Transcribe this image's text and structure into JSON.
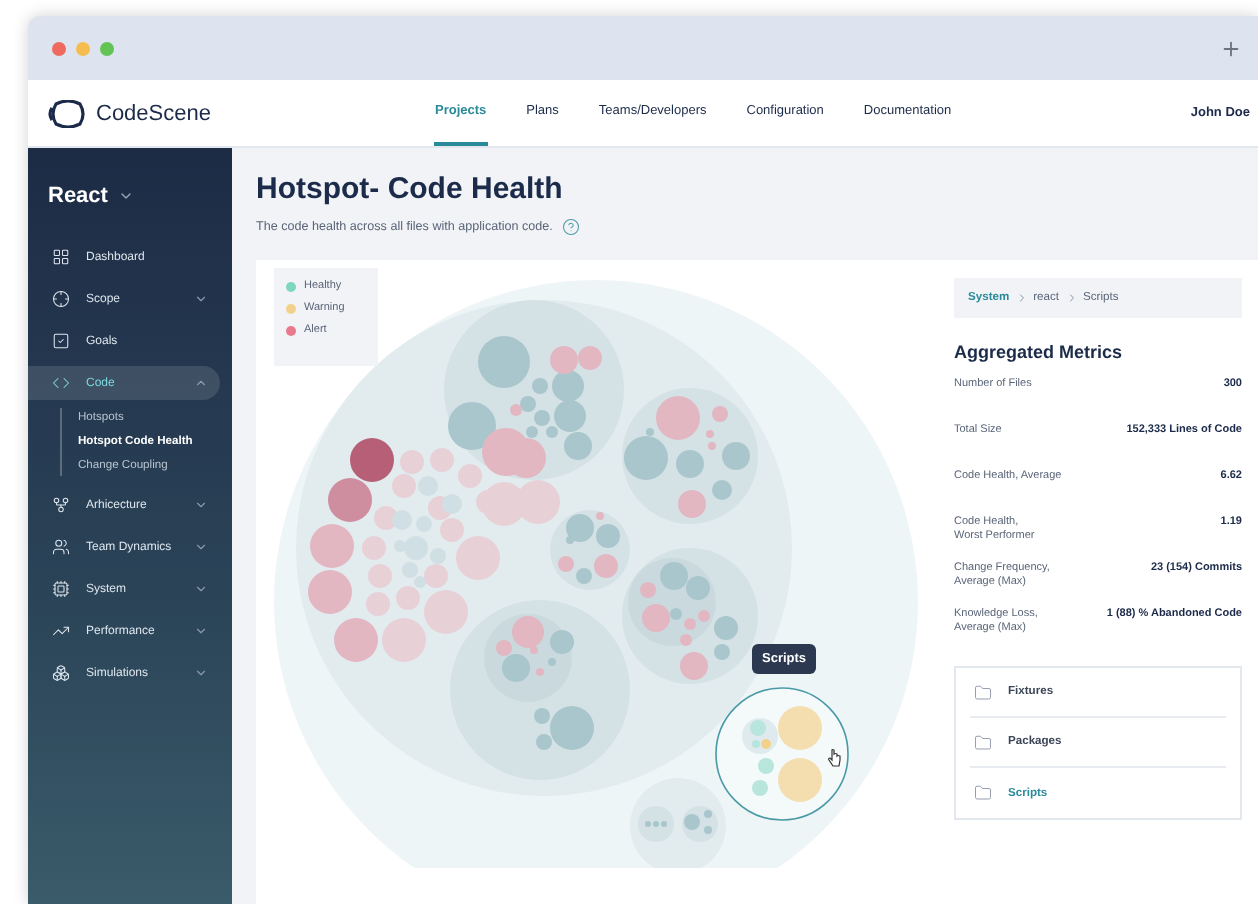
{
  "app": {
    "name": "CodeScene",
    "user": "John Doe"
  },
  "nav": [
    {
      "label": "Projects",
      "selected": true
    },
    {
      "label": "Plans",
      "selected": false
    },
    {
      "label": "Teams/Developers",
      "selected": false
    },
    {
      "label": "Configuration",
      "selected": false
    },
    {
      "label": "Documentation",
      "selected": false
    }
  ],
  "project": "React",
  "sidebar": {
    "items": [
      {
        "kind": "link",
        "label": "Dashboard",
        "selected": false
      },
      {
        "kind": "group",
        "label": "Scope",
        "selected": false,
        "expanded": false
      },
      {
        "kind": "link",
        "label": "Goals",
        "selected": false
      },
      {
        "kind": "group",
        "label": "Code",
        "selected": true,
        "expanded": true,
        "children": [
          {
            "label": "Hotspots",
            "selected": false
          },
          {
            "label": "Hotspot Code Health",
            "selected": true
          },
          {
            "label": "Change Coupling",
            "selected": false
          }
        ]
      },
      {
        "kind": "group",
        "label": "Arhicecture",
        "selected": false,
        "expanded": false
      },
      {
        "kind": "group",
        "label": "Team Dynamics",
        "selected": false,
        "expanded": false
      },
      {
        "kind": "group",
        "label": "System",
        "selected": false,
        "expanded": false
      },
      {
        "kind": "group",
        "label": "Performance",
        "selected": false,
        "expanded": false
      },
      {
        "kind": "group",
        "label": "Simulations",
        "selected": false,
        "expanded": false
      }
    ]
  },
  "page": {
    "title": "Hotspot- Code Health",
    "subtitle": "The code health across all files with application code."
  },
  "legend": [
    {
      "label": "Healthy",
      "color": "#7fd6bf"
    },
    {
      "label": "Warning",
      "color": "#f2d28a"
    },
    {
      "label": "Alert",
      "color": "#e9798d"
    }
  ],
  "tooltip": "Scripts",
  "breadcrumb": [
    "System",
    "react",
    "Scripts"
  ],
  "metrics": {
    "title": "Aggregated Metrics",
    "rows": [
      {
        "label": "Number of Files",
        "value": "300"
      },
      {
        "label": "Total Size",
        "value": "152,333 Lines of Code"
      },
      {
        "label": "Code Health, Average",
        "value": "6.62"
      },
      {
        "label": "Code Health,\nWorst Performer",
        "value": "1.19"
      },
      {
        "label": "Change Frequency,\nAverage (Max)",
        "value": "23 (154) Commits"
      },
      {
        "label": "Knowledge Loss,\nAverage (Max)",
        "value": "1 (88) % Abandoned Code"
      }
    ]
  },
  "folders": [
    {
      "name": "Fixtures",
      "selected": false
    },
    {
      "name": "Packages",
      "selected": false
    },
    {
      "name": "Scripts",
      "selected": true
    }
  ]
}
